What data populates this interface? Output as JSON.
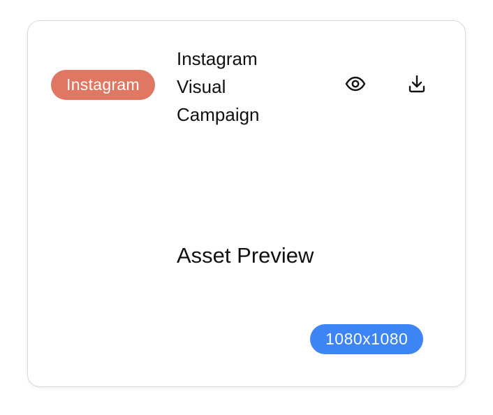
{
  "card": {
    "platform_badge": "Instagram",
    "title_lines": [
      "Instagram",
      "Visual",
      "Campaign"
    ],
    "preview_label": "Asset Preview",
    "size_badge": "1080x1080",
    "actions": {
      "view_icon": "eye-icon",
      "download_icon": "download-icon"
    },
    "colors": {
      "platform_badge_bg": "#df7762",
      "size_badge_bg": "#3d84f5",
      "text": "#111111",
      "border": "#d9d9d9"
    }
  }
}
